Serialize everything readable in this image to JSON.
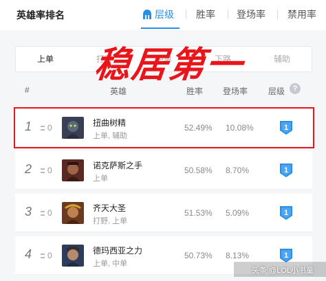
{
  "page_title": "英雄率排名",
  "tabs": [
    {
      "label": "层级",
      "icon": "helmet-icon",
      "active": true
    },
    {
      "label": "胜率",
      "active": false
    },
    {
      "label": "登场率",
      "active": false
    },
    {
      "label": "禁用率",
      "active": false
    }
  ],
  "lanes": [
    {
      "label": "上单",
      "active": true
    },
    {
      "label": "打野",
      "active": false
    },
    {
      "label": "中单",
      "active": false
    },
    {
      "label": "下路",
      "active": false
    },
    {
      "label": "辅助",
      "active": false
    }
  ],
  "overlay_caption": "稳居第一",
  "columns": {
    "rank": "#",
    "hero": "英雄",
    "winrate": "胜率",
    "pickrate": "登场率",
    "tier": "层级"
  },
  "help_icon": "?",
  "rows": [
    {
      "rank": "1",
      "trend": "0",
      "name": "扭曲树精",
      "roles": "上单, 辅助",
      "winrate": "52.49%",
      "pickrate": "10.08%",
      "tier": "1",
      "avatar_color": "#3a3f55"
    },
    {
      "rank": "2",
      "trend": "0",
      "name": "诺克萨斯之手",
      "roles": "上单",
      "winrate": "50.58%",
      "pickrate": "8.70%",
      "tier": "1",
      "avatar_color": "#5a2a22"
    },
    {
      "rank": "3",
      "trend": "0",
      "name": "齐天大圣",
      "roles": "打野, 上单",
      "winrate": "51.53%",
      "pickrate": "5.09%",
      "tier": "1",
      "avatar_color": "#6a3a20"
    },
    {
      "rank": "4",
      "trend": "0",
      "name": "德玛西亚之力",
      "roles": "上单, 中单",
      "winrate": "50.73%",
      "pickrate": "8.13%",
      "tier": "1",
      "avatar_color": "#2c3c5a"
    }
  ],
  "watermark": "头条 @LOL小书童",
  "colors": {
    "accent": "#2a8fe6",
    "highlight": "#e8151a",
    "tier_badge": "#2a8fe6"
  }
}
